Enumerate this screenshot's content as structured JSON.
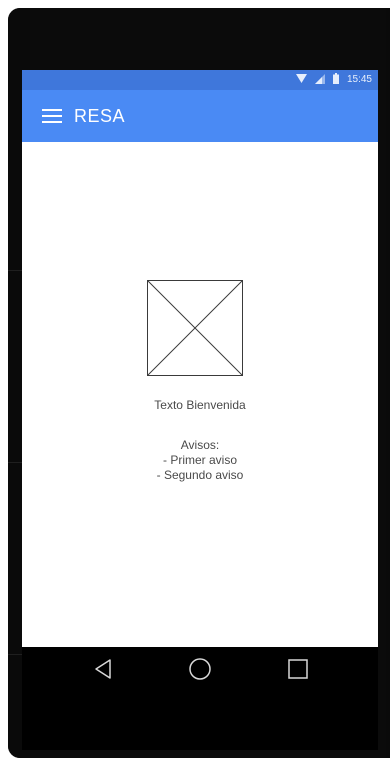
{
  "status_bar": {
    "time": "15:45",
    "icons": [
      "wifi-icon",
      "cell-signal-icon",
      "battery-icon"
    ],
    "color": "#3f77db"
  },
  "app_bar": {
    "title": "RESA",
    "menu_icon": "hamburger-menu-icon",
    "color": "#4a8af4"
  },
  "content": {
    "image_icon": "image-placeholder-icon",
    "welcome_text": "Texto Bienvenida",
    "notices_title": "Avisos:",
    "notices": [
      "- Primer aviso",
      "- Segundo aviso"
    ]
  },
  "nav_bar": {
    "buttons": [
      "back-icon",
      "home-icon",
      "recents-icon"
    ]
  }
}
